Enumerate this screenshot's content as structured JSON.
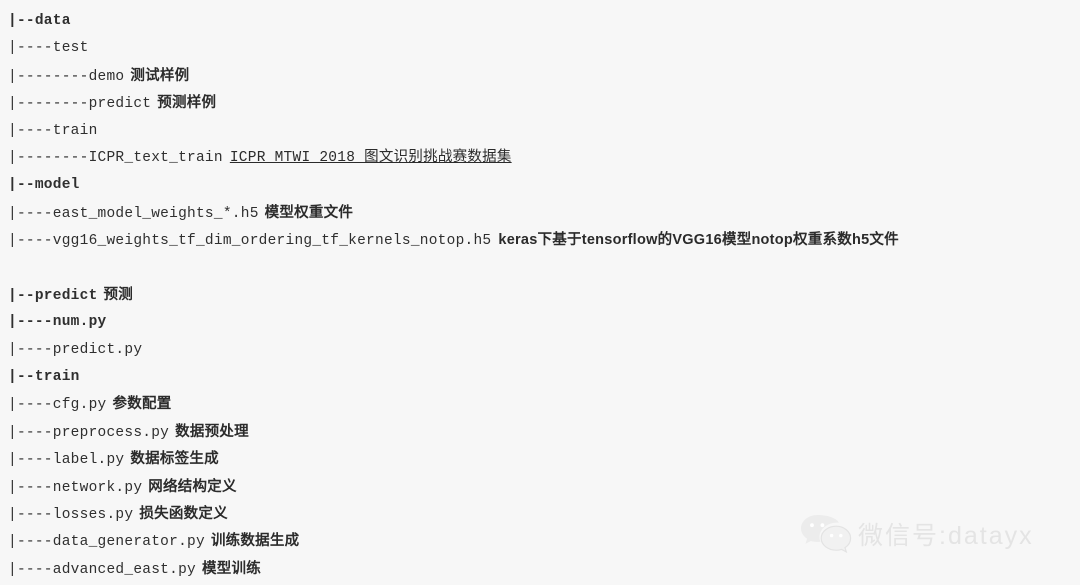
{
  "page": {
    "background_color": "#f7f7f7",
    "text_color": "#2f2f2f"
  },
  "tree": {
    "lines": [
      {
        "path": "|--data",
        "bold": true,
        "note": "",
        "note_style": "none"
      },
      {
        "path": "|----test",
        "bold": false,
        "note": "",
        "note_style": "none"
      },
      {
        "path": "|--------demo",
        "bold": false,
        "note": "测试样例",
        "note_style": "cn"
      },
      {
        "path": "|--------predict",
        "bold": false,
        "note": "预测样例",
        "note_style": "cn"
      },
      {
        "path": "|----train",
        "bold": false,
        "note": "",
        "note_style": "none"
      },
      {
        "path": "|--------ICPR_text_train",
        "bold": false,
        "note": "ICPR MTWI 2018 图文识别挑战赛数据集",
        "note_style": "link"
      },
      {
        "path": "|--model",
        "bold": true,
        "note": "",
        "note_style": "none"
      },
      {
        "path": "|----east_model_weights_*.h5",
        "bold": false,
        "note": "模型权重文件",
        "note_style": "cn"
      },
      {
        "path": "|----vgg16_weights_tf_dim_ordering_tf_kernels_notop.h5",
        "bold": false,
        "note": "keras下基于tensorflow的VGG16模型notop权重系数h5文件",
        "note_style": "mixed"
      },
      {
        "path": "",
        "bold": false,
        "note": "",
        "note_style": "spacer"
      },
      {
        "path": "|--predict",
        "bold": true,
        "note": "预测",
        "note_style": "cn"
      },
      {
        "path": "|----num.py",
        "bold": true,
        "note": "",
        "note_style": "none"
      },
      {
        "path": "|----predict.py",
        "bold": false,
        "note": "",
        "note_style": "none"
      },
      {
        "path": "|--train",
        "bold": true,
        "note": "",
        "note_style": "none"
      },
      {
        "path": "|----cfg.py",
        "bold": false,
        "note": "参数配置",
        "note_style": "cn"
      },
      {
        "path": "|----preprocess.py",
        "bold": false,
        "note": "数据预处理",
        "note_style": "cn"
      },
      {
        "path": "|----label.py",
        "bold": false,
        "note": "数据标签生成",
        "note_style": "cn"
      },
      {
        "path": "|----network.py",
        "bold": false,
        "note": "网络结构定义",
        "note_style": "cn"
      },
      {
        "path": "|----losses.py",
        "bold": false,
        "note": "损失函数定义",
        "note_style": "cn"
      },
      {
        "path": "|----data_generator.py",
        "bold": false,
        "note": "训练数据生成",
        "note_style": "cn"
      },
      {
        "path": "|----advanced_east.py",
        "bold": false,
        "note": "模型训练",
        "note_style": "cn"
      }
    ]
  },
  "watermark": {
    "icon": "wechat-icon",
    "text": "微信号:datayx",
    "color": "#e4e4e4"
  }
}
